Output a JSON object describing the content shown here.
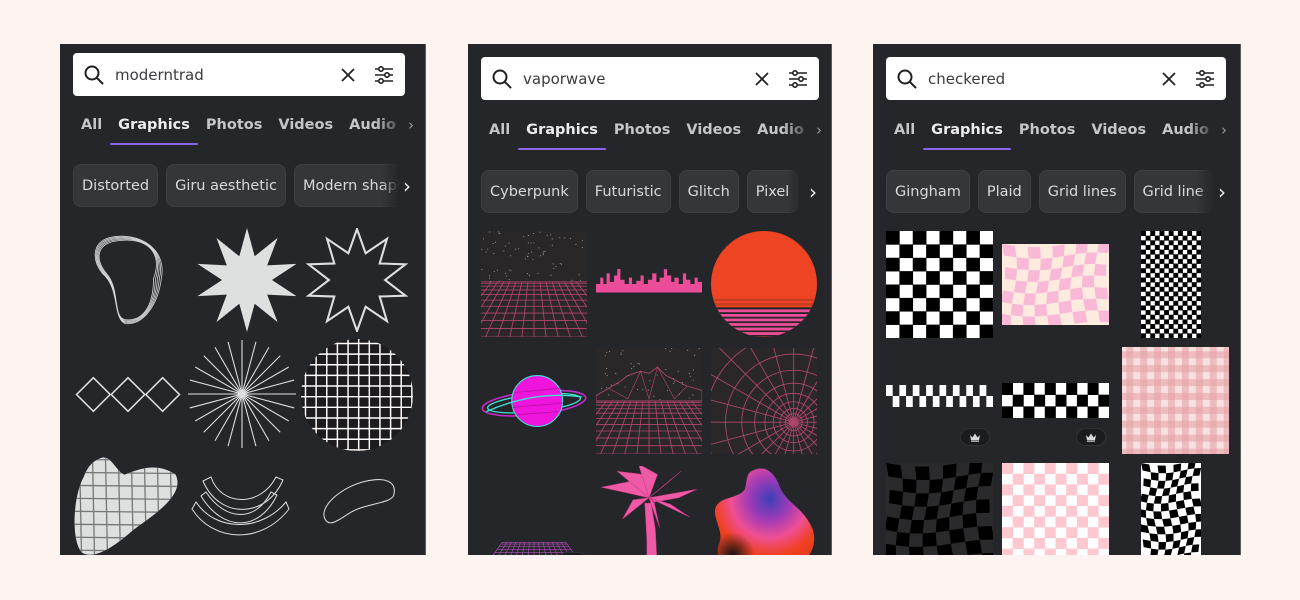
{
  "panels": [
    {
      "search": {
        "query": "moderntrad",
        "search_icon": "search-icon",
        "clear_icon": "close-icon",
        "filter_icon": "filter-sliders-icon"
      },
      "tabs": [
        "All",
        "Graphics",
        "Photos",
        "Videos",
        "Audio"
      ],
      "active_tab": "Graphics",
      "chips": [
        "Distorted",
        "Giru aesthetic",
        "Modern shape"
      ],
      "results": [
        {
          "name": "wavy-outline-rings"
        },
        {
          "name": "filled-star-burst"
        },
        {
          "name": "outline-star-burst"
        },
        {
          "name": "outline-diamond-chain"
        },
        {
          "name": "line-starburst"
        },
        {
          "name": "grid-circle"
        },
        {
          "name": "grid-blob"
        },
        {
          "name": "outline-arches"
        },
        {
          "name": "outline-bean-shape"
        }
      ]
    },
    {
      "search": {
        "query": "vaporwave",
        "search_icon": "search-icon",
        "clear_icon": "close-icon",
        "filter_icon": "filter-sliders-icon"
      },
      "tabs": [
        "All",
        "Graphics",
        "Photos",
        "Videos",
        "Audio"
      ],
      "active_tab": "Graphics",
      "chips": [
        "Cyberpunk",
        "Futuristic",
        "Glitch",
        "Pixel"
      ],
      "results": [
        {
          "name": "starry-grid-horizon"
        },
        {
          "name": "pink-city-skyline"
        },
        {
          "name": "retro-sunset"
        },
        {
          "name": "neon-ringed-planet"
        },
        {
          "name": "wireframe-mountains"
        },
        {
          "name": "wireframe-tunnel"
        },
        {
          "name": "perspective-grid-floor",
          "premium": true
        },
        {
          "name": "pink-palm-tree"
        },
        {
          "name": "gradient-blob"
        }
      ]
    },
    {
      "search": {
        "query": "checkered",
        "search_icon": "search-icon",
        "clear_icon": "close-icon",
        "filter_icon": "filter-sliders-icon"
      },
      "tabs": [
        "All",
        "Graphics",
        "Photos",
        "Videos",
        "Audio"
      ],
      "active_tab": "Graphics",
      "chips": [
        "Gingham",
        "Plaid",
        "Grid lines",
        "Grid line"
      ],
      "results": [
        {
          "name": "black-white-checkerboard"
        },
        {
          "name": "wavy-pink-checker"
        },
        {
          "name": "small-checker-tall"
        },
        {
          "name": "checker-border-strip",
          "premium": true
        },
        {
          "name": "checker-band",
          "premium": true
        },
        {
          "name": "pink-gingham"
        },
        {
          "name": "warped-dark-checker",
          "premium": true
        },
        {
          "name": "pink-white-checker",
          "premium": true
        },
        {
          "name": "warped-bw-checker-tall"
        }
      ]
    }
  ],
  "colors": {
    "page_bg": "#fdf4f1",
    "panel_bg": "#252629",
    "tab_underline": "#8b65e8",
    "chip_bg": "#35363a",
    "neon_pink": "#e94e9b",
    "sun_orange": "#ee4423",
    "light_pink": "#f9b8d6"
  },
  "premium_icon": "crown-icon"
}
